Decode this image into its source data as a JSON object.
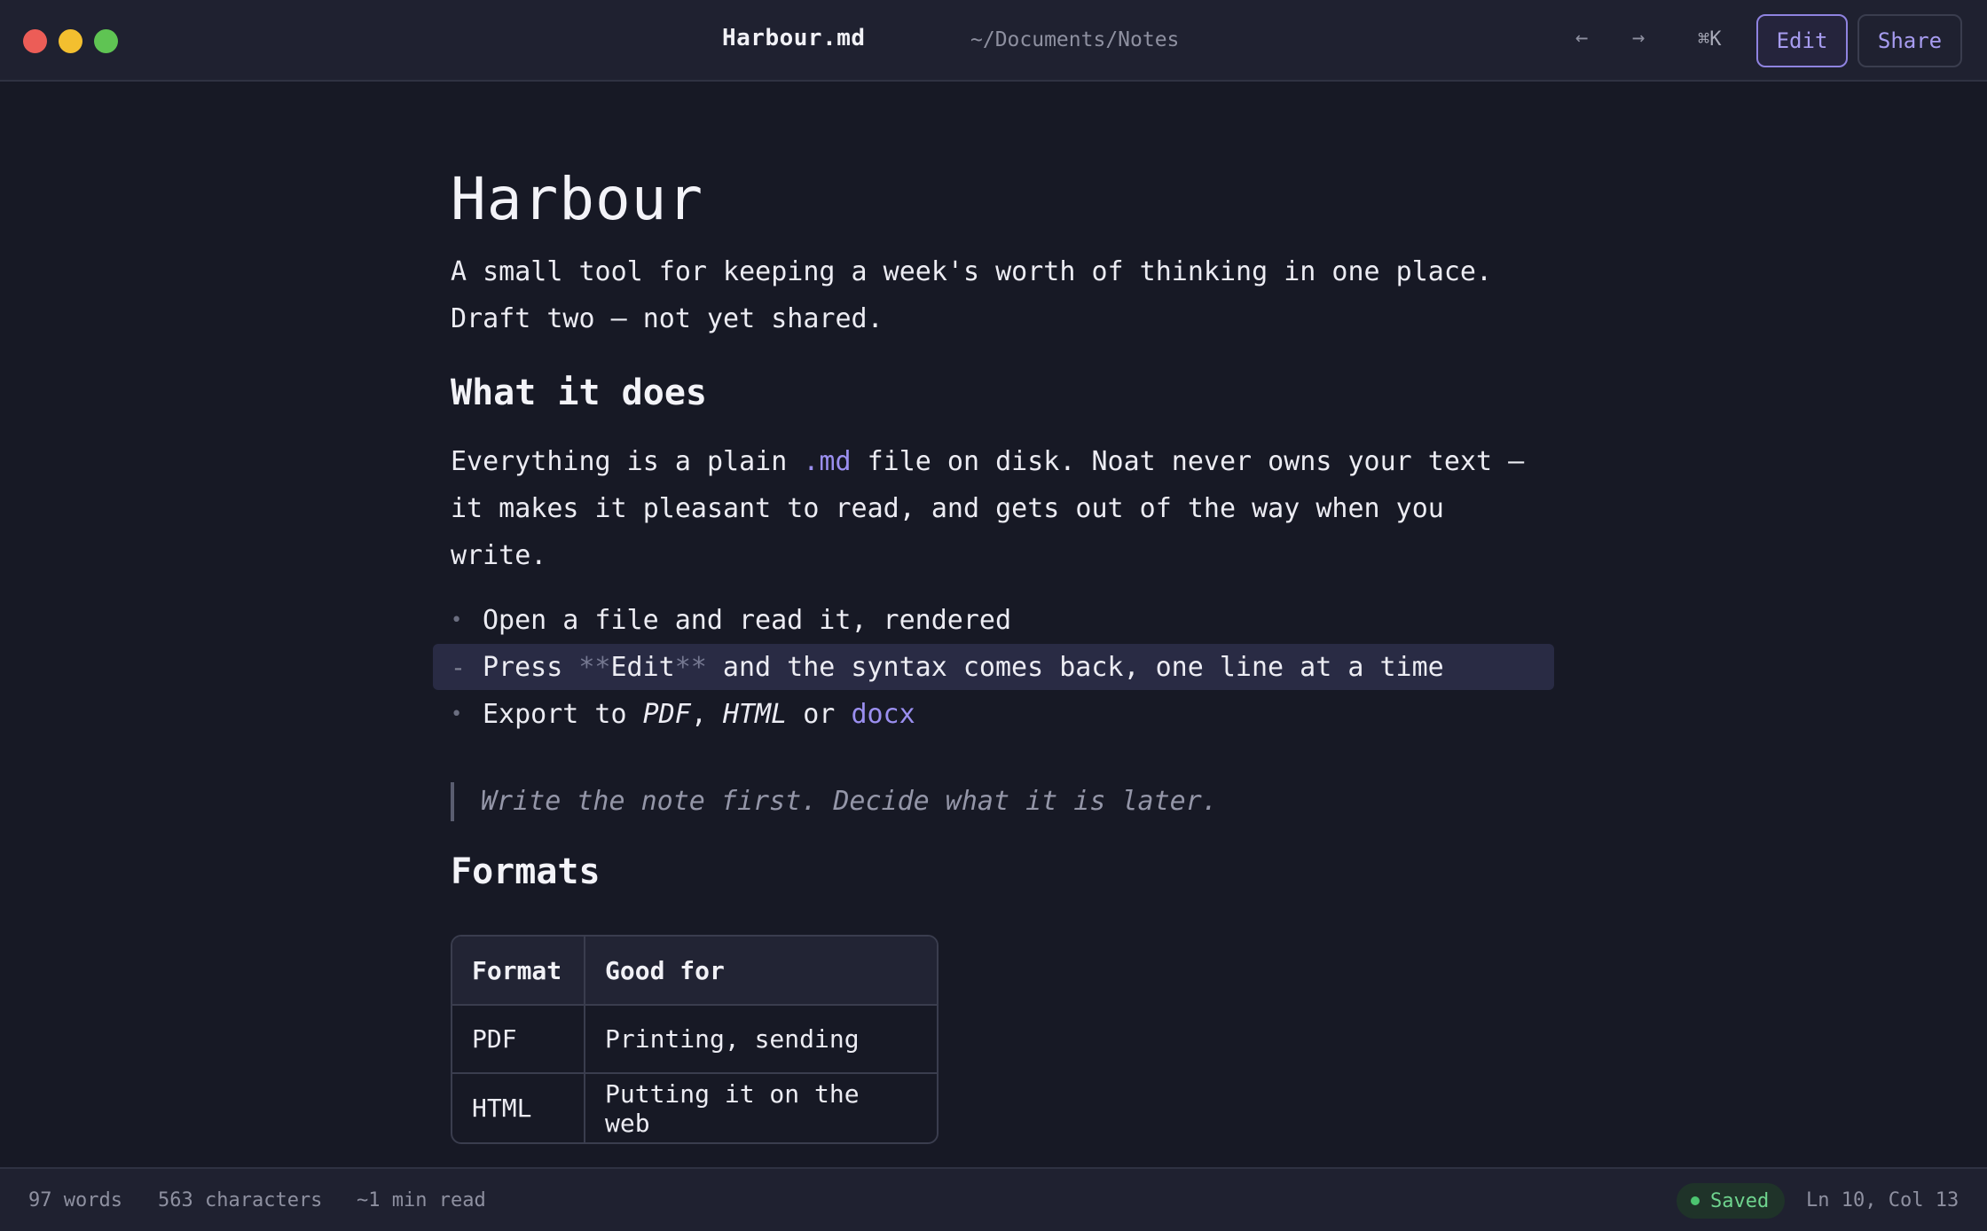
{
  "window": {
    "title": "Harbour.md",
    "path": "~/Documents/Notes",
    "nav_back": "←",
    "nav_forward": "→",
    "command_shortcut": "⌘K",
    "edit_label": "Edit",
    "share_label": "Share"
  },
  "document": {
    "title": "Harbour",
    "lead": "A small tool for keeping a week's worth of thinking in one place.\nDraft two — not yet shared.",
    "section1": {
      "heading": "What it does",
      "body_before_link": "Everything is a plain ",
      "body_link": ".md",
      "body_after_link": " file on disk. Noat never owns your text —\nit makes it pleasant to read, and gets out of the way when you\nwrite."
    },
    "bullets": {
      "item1": {
        "marker": "•",
        "text": "Open a file and read it, rendered"
      },
      "item2": {
        "marker": "-",
        "before": "Press ",
        "syntax_open": "**",
        "bold": "Edit",
        "syntax_close": "**",
        "after": " and the syntax comes back, one line at a time"
      },
      "item3": {
        "marker": "•",
        "before": "Export to ",
        "pdf": "PDF",
        "sep": ", ",
        "html": "HTML",
        "or": " or ",
        "docx": "docx"
      }
    },
    "quote": "Write the note first. Decide what it is later.",
    "section2": {
      "heading": "Formats",
      "table": {
        "headers": [
          "Format",
          "Good for"
        ],
        "rows": [
          [
            "PDF",
            "Printing, sending"
          ],
          [
            "HTML",
            "Putting it on the web"
          ]
        ]
      }
    }
  },
  "status": {
    "words": "97 words",
    "characters": "563 characters",
    "read_time": "~1 min read",
    "saved": "Saved",
    "cursor": "Ln 10, Col 13"
  },
  "colors": {
    "accent": "#9b8ff0",
    "background": "#171925",
    "saved_green": "#4cc470"
  }
}
